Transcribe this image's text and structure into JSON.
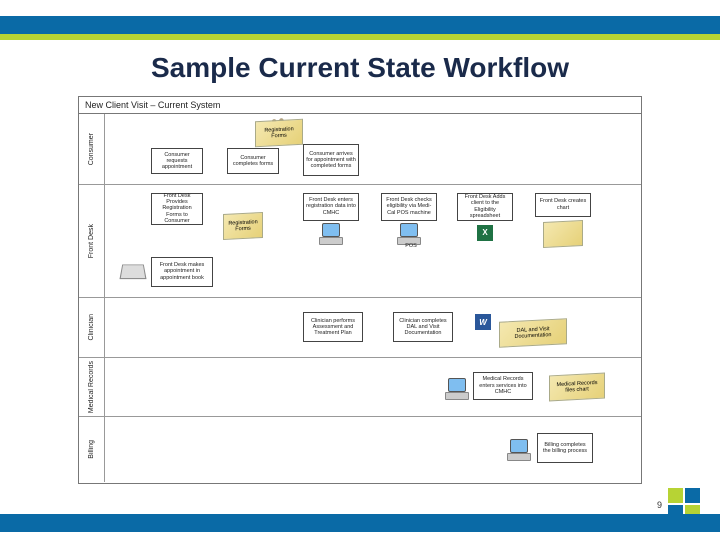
{
  "title": "Sample Current State Workflow",
  "diagram": {
    "title": "New Client Visit – Current System",
    "lanes": [
      "Consumer",
      "Front Desk",
      "Clinician",
      "Medical Records",
      "Billing"
    ],
    "consumer": {
      "b1": "Consumer requests appointment",
      "b2": "Consumer completes forms",
      "b3": "Consumer arrives for appointment with completed forms",
      "topdoc": "Registration Forms"
    },
    "frontdesk": {
      "b1": "Front Desk Provides Registration Forms to Consumer",
      "doc1": "Registration Forms",
      "b2": "Front Desk enters registration data into CMHC",
      "b3": "Front Desk checks eligibility via Medi-Cal POS machine",
      "b4": "Front Desk Adds client to the Eligibility spreadsheet",
      "b5": "Front Desk creates chart",
      "b6": "Front Desk makes appointment in appointment book",
      "pdf": "POS"
    },
    "clinician": {
      "b1": "Clinician performs Assessment and Treatment Plan",
      "b2": "Clinician completes DAL and Visit Documentation",
      "doc": "DAL and Visit Documentation"
    },
    "medrec": {
      "b1": "Medical Records enters services into CMHC",
      "doc": "Medical Records files chart"
    },
    "billing": {
      "b1": "Billing completes the billing process"
    },
    "icons": {
      "people": "group-icon",
      "computer": "computer-icon",
      "book": "appointment-book-icon",
      "pdf": "pdf-icon",
      "excel": "excel-icon",
      "word": "word-icon"
    }
  },
  "slide_number": "9",
  "colors": {
    "brand_blue": "#0a6aa6",
    "brand_green": "#b7d334"
  }
}
